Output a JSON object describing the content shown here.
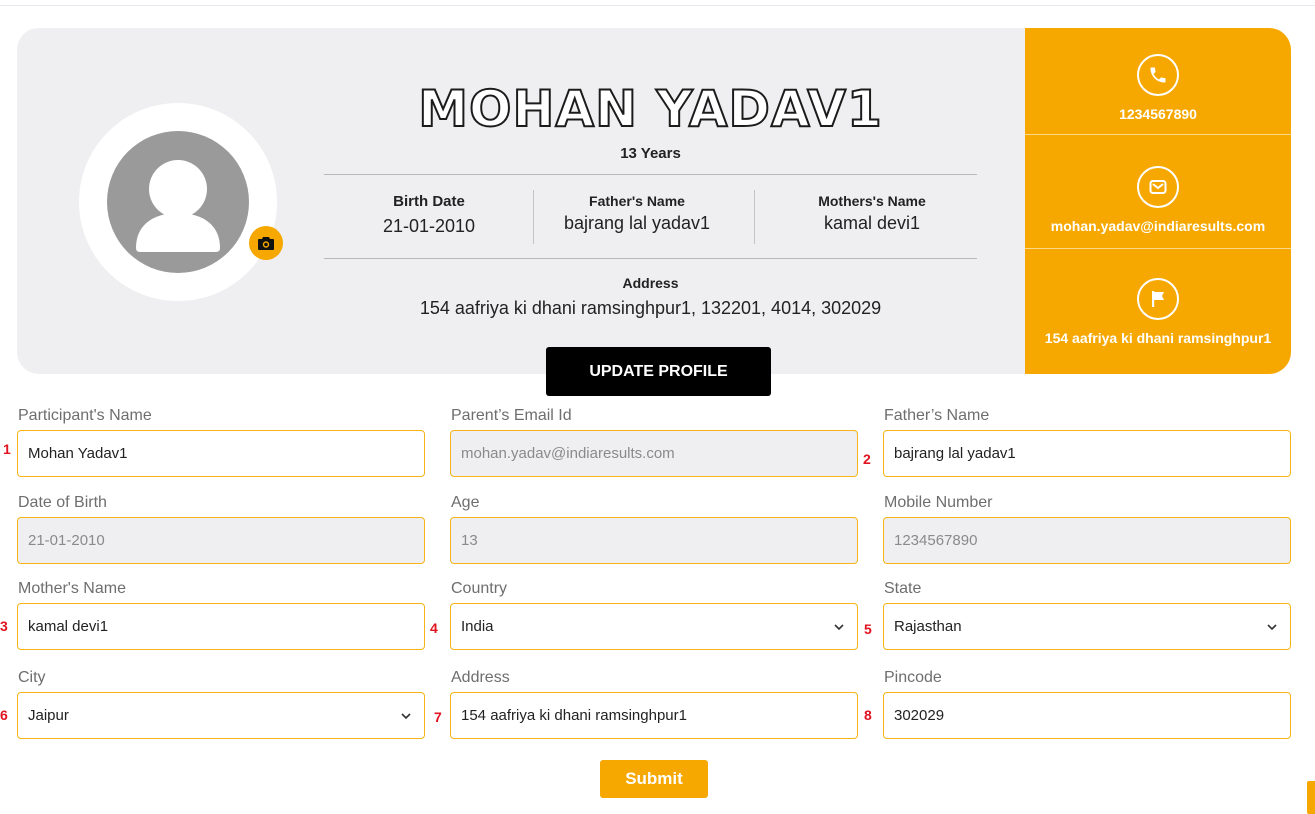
{
  "profile": {
    "name": "MOHAN YADAV1",
    "age": "13 Years",
    "birth_date_label": "Birth Date",
    "birth_date": "21-01-2010",
    "father_label": "Father's Name",
    "father": "bajrang lal yadav1",
    "mother_label": "Mothers's Name",
    "mother": "kamal devi1",
    "address_label": "Address",
    "address": "154 aafriya ki dhani ramsinghpur1, 132201, 4014, 302029",
    "update_button": "UPDATE PROFILE"
  },
  "contact": {
    "phone": "1234567890",
    "email": "mohan.yadav@indiaresults.com",
    "address": "154 aafriya ki dhani ramsinghpur1"
  },
  "form": {
    "participant_name": {
      "label": "Participant's Name",
      "value": "Mohan Yadav1",
      "marker": "1"
    },
    "parent_email": {
      "label": "Parent’s Email Id",
      "value": "mohan.yadav@indiaresults.com"
    },
    "father_name": {
      "label": "Father’s Name",
      "value": "bajrang lal yadav1",
      "marker": "2"
    },
    "dob": {
      "label": "Date of Birth",
      "value": "21-01-2010"
    },
    "age": {
      "label": "Age",
      "value": "13"
    },
    "mobile": {
      "label": "Mobile Number",
      "value": "1234567890"
    },
    "mother_name": {
      "label": "Mother's Name",
      "value": "kamal devi1",
      "marker": "3"
    },
    "country": {
      "label": "Country",
      "value": "India",
      "marker": "4"
    },
    "state": {
      "label": "State",
      "value": "Rajasthan",
      "marker": "5"
    },
    "city": {
      "label": "City",
      "value": "Jaipur",
      "marker": "6"
    },
    "address": {
      "label": "Address",
      "value": "154 aafriya ki dhani ramsinghpur1",
      "marker": "7"
    },
    "pincode": {
      "label": "Pincode",
      "value": "302029",
      "marker": "8"
    },
    "submit": "Submit"
  },
  "colors": {
    "accent": "#f6a800",
    "marker": "#e0131f",
    "card_bg": "#efeff1"
  },
  "icons": [
    "camera-icon",
    "phone-icon",
    "mail-icon",
    "flag-icon",
    "chevron-down-icon"
  ]
}
